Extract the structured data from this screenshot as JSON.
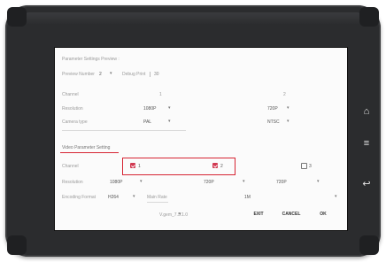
{
  "preview": {
    "section_title": "Parameter Settings Preview :",
    "preview_number_label": "Preview Number",
    "preview_number_value": "2",
    "debug_print_label": "Debug Print",
    "debug_print_value": "30",
    "channel_label": "Channel",
    "channel_1": "1",
    "channel_2": "2",
    "resolution_label": "Resolution",
    "resolution_1": "1080P",
    "resolution_2": "720P",
    "camera_type_label": "Camera type",
    "camera_type_1": "PAL",
    "camera_type_2": "NTSC"
  },
  "video": {
    "section_title": "Video Parameter Setting",
    "channel_label": "Channel",
    "channels": [
      {
        "label": "1",
        "checked": true
      },
      {
        "label": "2",
        "checked": true
      },
      {
        "label": "3",
        "checked": false
      }
    ],
    "resolution_label": "Resolution",
    "resolutions": [
      "1080P",
      "720P",
      "720P"
    ],
    "encoding_format_label": "Encoding Format",
    "encoding_format_value": "H264",
    "main_rate_label": "Main Rate",
    "main_rate_value": "1M",
    "version_text": "V.gem_7.5.1.0"
  },
  "buttons": {
    "exit": "EXIT",
    "cancel": "CANCEL",
    "ok": "OK"
  },
  "side_keys": {
    "home": "⌂",
    "menu": "≡",
    "back": "↩"
  },
  "colors": {
    "accent": "#d13a52",
    "highlight": "#d62433",
    "bezel": "#2b2c2e"
  }
}
